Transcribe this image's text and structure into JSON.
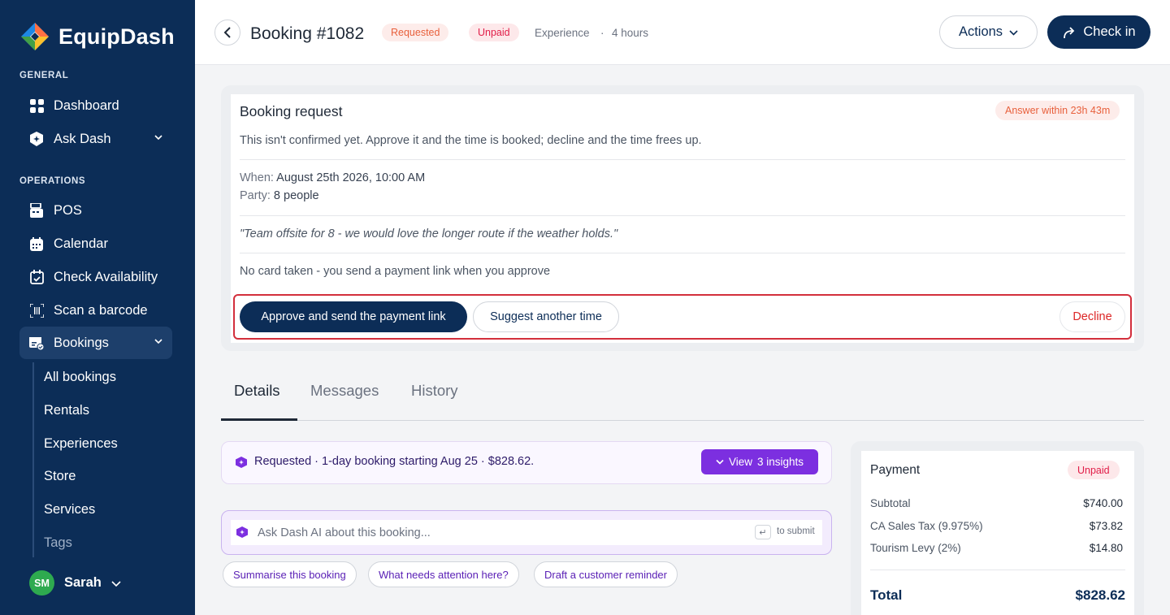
{
  "brand": {
    "name": "EquipDash"
  },
  "sidebar": {
    "general_label": "GENERAL",
    "operations_label": "OPERATIONS",
    "general_items": [
      {
        "label": "Dashboard",
        "icon": "grid-icon"
      },
      {
        "label": "Ask Dash",
        "icon": "sparkle-shield-icon"
      }
    ],
    "operation_items": [
      {
        "label": "POS",
        "icon": "register-icon"
      },
      {
        "label": "Calendar",
        "icon": "calendar-icon"
      },
      {
        "label": "Check Availability",
        "icon": "calendar-check-icon"
      },
      {
        "label": "Scan a barcode",
        "icon": "barcode-scan-icon"
      },
      {
        "label": "Bookings",
        "icon": "bookings-icon"
      }
    ],
    "booking_sub_items": [
      {
        "label": "All bookings"
      },
      {
        "label": "Rentals"
      },
      {
        "label": "Experiences"
      },
      {
        "label": "Store"
      },
      {
        "label": "Services"
      },
      {
        "label": "Tags"
      }
    ],
    "user": {
      "initials": "SM",
      "name": "Sarah"
    }
  },
  "header": {
    "title": "Booking #1082",
    "status": "Requested",
    "payment_status": "Unpaid",
    "type": "Experience",
    "separator": "·",
    "duration": "4 hours",
    "actions_label": "Actions",
    "checkin_label": "Check in"
  },
  "request": {
    "title": "Booking request",
    "deadline": "Answer within 23h 43m",
    "description": "This isn't confirmed yet. Approve it and the time is booked; decline and the time frees up.",
    "when_label": "When:",
    "when_value": "August 25th 2026, 10:00 AM",
    "party_label": "Party:",
    "party_value": "8 people",
    "note": "\"Team offsite for 8 - we would love the longer route if the weather holds.\"",
    "payment_note": "No card taken - you send a payment link when you approve",
    "approve_label": "Approve and send the payment link",
    "suggest_label": "Suggest another time",
    "decline_label": "Decline"
  },
  "tabs": [
    {
      "label": "Details"
    },
    {
      "label": "Messages"
    },
    {
      "label": "History"
    }
  ],
  "insights": {
    "summary": "Requested · 1-day booking starting Aug 25 · $828.62.",
    "view_label": "View",
    "count_label": "3 insights"
  },
  "ask": {
    "placeholder": "Ask Dash AI about this booking...",
    "enter_symbol": "↵",
    "hint": "to submit",
    "chips": [
      {
        "label": "Summarise this booking"
      },
      {
        "label": "What needs attention here?"
      },
      {
        "label": "Draft a customer reminder"
      }
    ]
  },
  "payment": {
    "title": "Payment",
    "status": "Unpaid",
    "rows": [
      {
        "label": "Subtotal",
        "amount": "$740.00"
      },
      {
        "label": "CA Sales Tax (9.975%)",
        "amount": "$73.82"
      },
      {
        "label": "Tourism Levy (2%)",
        "amount": "$14.80"
      }
    ],
    "total_label": "Total",
    "total_amount": "$828.62"
  },
  "colors": {
    "sidebar_bg": "#0c2d57",
    "primary": "#0c2d57",
    "accent_purple": "#7c2fe0",
    "danger": "#dc2626",
    "warning_text": "#e8603c",
    "highlight_border": "#d32f3c"
  }
}
